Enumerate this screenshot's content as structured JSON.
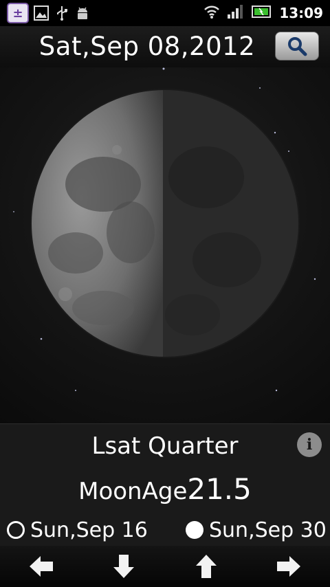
{
  "status_bar": {
    "time": "13:09",
    "icons": [
      "calendar-app-icon",
      "image-icon",
      "usb-icon",
      "android-debug-icon",
      "wifi-icon",
      "signal-icon",
      "battery-icon"
    ]
  },
  "header": {
    "date": "Sat,Sep 08,2012",
    "search_icon": "search-icon"
  },
  "moon": {
    "phase_name": "Lsat Quarter",
    "age_label": "MoonAge",
    "age_value": "21.5",
    "illumination_side": "left"
  },
  "next_phases": [
    {
      "symbol": "new-moon-outline",
      "date": "Sun,Sep 16"
    },
    {
      "symbol": "full-moon-filled",
      "date": "Sun,Sep 30"
    }
  ],
  "bottom_nav": {
    "buttons": [
      "arrow-left-icon",
      "arrow-down-icon",
      "arrow-up-icon",
      "arrow-right-icon"
    ]
  },
  "colors": {
    "background": "#000000",
    "panel": "#1a1a1a",
    "text": "#ffffff",
    "battery": "#3bbf2f",
    "app_icon_accent": "#7b5aa6"
  }
}
